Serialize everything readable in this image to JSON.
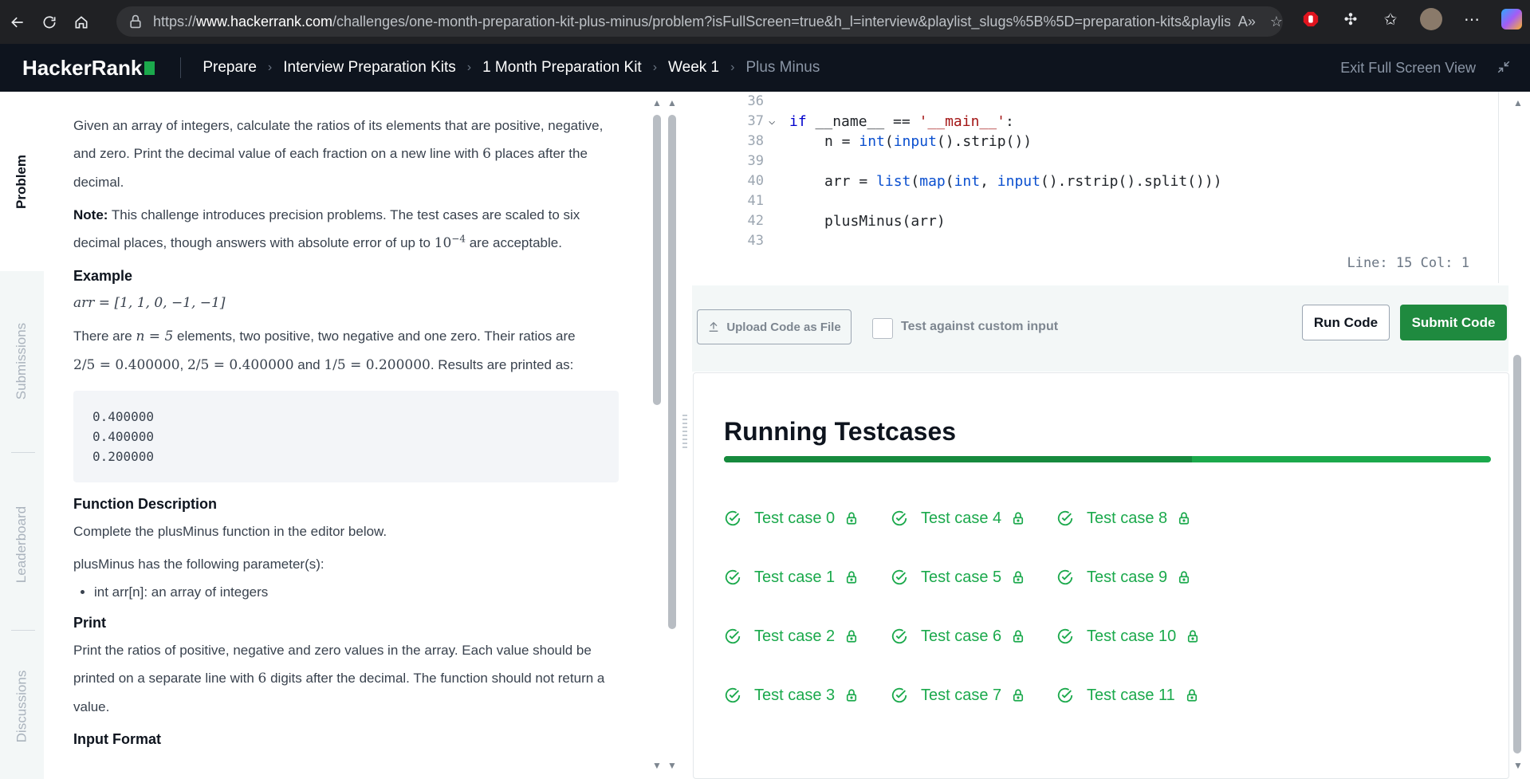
{
  "browser": {
    "url_prefix": "https://",
    "url_domain": "www.hackerrank.com",
    "url_path": "/challenges/one-month-preparation-kit-plus-minus/problem?isFullScreen=true&h_l=interview&playlist_slugs%5B%5D=preparation-kits&playlist..."
  },
  "header": {
    "logo": "HackerRank",
    "breadcrumbs": [
      "Prepare",
      "Interview Preparation Kits",
      "1 Month Preparation Kit",
      "Week 1",
      "Plus Minus"
    ],
    "exit_fullscreen": "Exit Full Screen View"
  },
  "side_tabs": [
    "Problem",
    "Submissions",
    "Leaderboard",
    "Discussions"
  ],
  "problem": {
    "intro_a": "Given an array of integers, calculate the ratios of its elements that are positive, negative, and zero. Print the decimal value of each fraction on a new line with ",
    "intro_six": "6",
    "intro_b": " places after the decimal.",
    "note_label": "Note:",
    "note_a": " This challenge introduces precision problems. The test cases are scaled to six decimal places, though answers with absolute error of up to ",
    "note_math": "10",
    "note_exp": "−4",
    "note_b": " are acceptable.",
    "example_heading": "Example",
    "example_arr": "arr = [1, 1, 0, −1, −1]",
    "explain_a": "There are ",
    "explain_n": "n = 5",
    "explain_b": " elements, two positive, two negative and one zero. Their ratios are",
    "ratio1": "2/5 = 0.400000",
    "ratio2": "2/5 = 0.400000",
    "ratio_and": " and ",
    "ratio3": "1/5 = 0.200000",
    "ratio_end": ". Results are printed as:",
    "output_lines": [
      "0.400000",
      "0.400000",
      "0.200000"
    ],
    "func_heading": "Function Description",
    "func_text": "Complete the plusMinus function in the editor below.",
    "params_text": "plusMinus has the following parameter(s):",
    "param_item": "int arr[n]: an array of integers",
    "print_heading": "Print",
    "print_a": "Print the ratios of positive, negative and zero values in the array. Each value should be printed on a separate line with ",
    "print_six": "6",
    "print_b": " digits after the decimal. The function should not return a value.",
    "input_heading": "Input Format"
  },
  "editor": {
    "line_numbers": [
      "36",
      "37",
      "38",
      "39",
      "40",
      "41",
      "42",
      "43"
    ],
    "status": "Line: 15 Col: 1"
  },
  "actions": {
    "upload": "Upload Code as File",
    "custom_input": "Test against custom input",
    "run": "Run Code",
    "submit": "Submit Code"
  },
  "testcases": {
    "title": "Running Testcases",
    "progress": 0.61,
    "columns": [
      [
        "Test case 0",
        "Test case 1",
        "Test case 2",
        "Test case 3"
      ],
      [
        "Test case 4",
        "Test case 5",
        "Test case 6",
        "Test case 7"
      ],
      [
        "Test case 8",
        "Test case 9",
        "Test case 10",
        "Test case 11"
      ]
    ],
    "status": "passed"
  },
  "colors": {
    "brand_green": "#1ba94c",
    "submit_green": "#1f8a3f",
    "header_bg": "#0e141e"
  }
}
